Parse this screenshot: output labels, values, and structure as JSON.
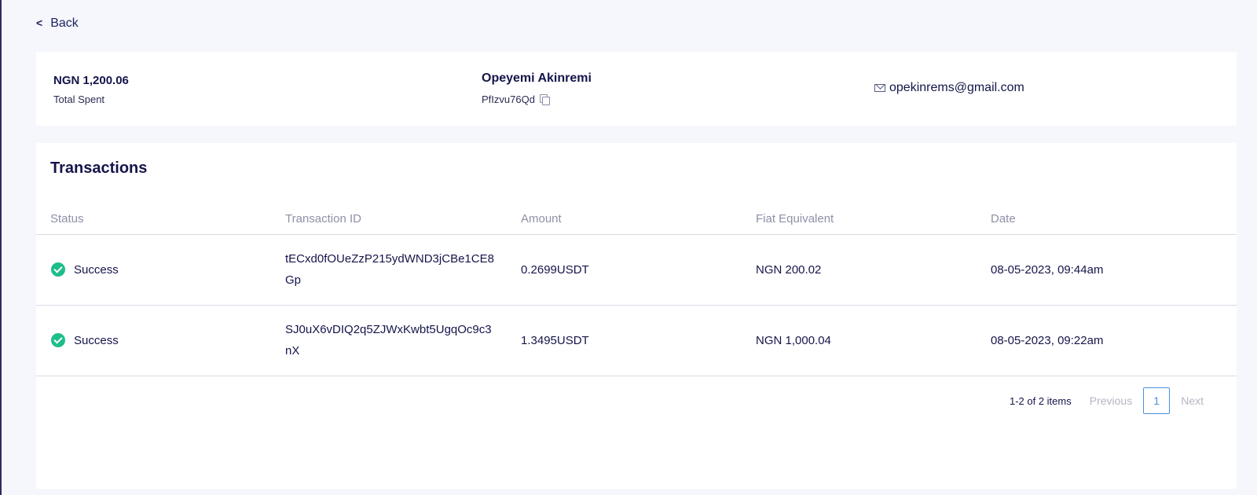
{
  "nav": {
    "back_label": "Back"
  },
  "summary": {
    "total_amount": "NGN 1,200.06",
    "total_label": "Total Spent",
    "customer_name": "Opeyemi Akinremi",
    "customer_id": "PfIzvu76Qd",
    "email": "opekinrems@gmail.com"
  },
  "transactions": {
    "title": "Transactions",
    "columns": [
      "Status",
      "Transaction ID",
      "Amount",
      "Fiat Equivalent",
      "Date"
    ],
    "rows": [
      {
        "status": "Success",
        "transaction_id": "tECxd0fOUeZzP215ydWND3jCBe1CE8Gp",
        "amount": "0.2699USDT",
        "fiat": "NGN 200.02",
        "date": "08-05-2023, 09:44am"
      },
      {
        "status": "Success",
        "transaction_id": "SJ0uX6vDIQ2q5ZJWxKwbt5UgqOc9c3nX",
        "amount": "1.3495USDT",
        "fiat": "NGN 1,000.04",
        "date": "08-05-2023, 09:22am"
      }
    ]
  },
  "pagination": {
    "info": "1-2 of 2 items",
    "previous_label": "Previous",
    "current_page": "1",
    "next_label": "Next"
  },
  "colors": {
    "accent": "#4a90e2",
    "success": "#1ebd8c",
    "text_primary": "#14154a",
    "text_muted": "#8e90a8"
  },
  "icons": {
    "back": "chevron-left-icon",
    "copy": "copy-icon",
    "email": "mail-icon",
    "status": "check-circle-icon"
  }
}
